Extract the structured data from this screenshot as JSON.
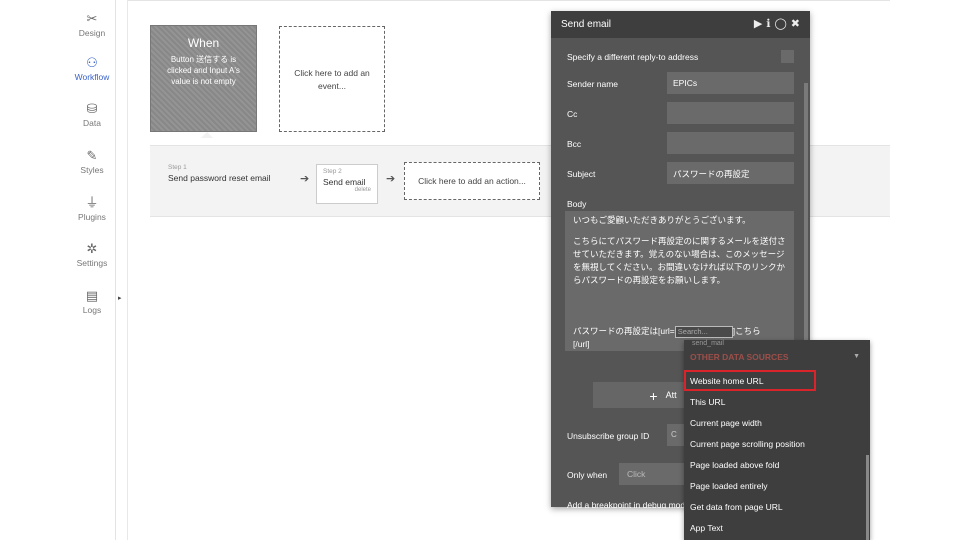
{
  "sidebar": {
    "items": [
      {
        "label": "Design",
        "icon": "✂"
      },
      {
        "label": "Workflow",
        "icon": "⚇"
      },
      {
        "label": "Data",
        "icon": "⛁"
      },
      {
        "label": "Styles",
        "icon": "✎"
      },
      {
        "label": "Plugins",
        "icon": "⏚"
      },
      {
        "label": "Settings",
        "icon": "✲"
      },
      {
        "label": "Logs",
        "icon": "▤"
      }
    ],
    "expand_icon": "▸"
  },
  "event": {
    "title": "When",
    "description": "Button 送信する is clicked and Input A's value is not empty",
    "add_event": "Click here to add an event..."
  },
  "actions": {
    "step1_label": "Step 1",
    "step1_title": "Send password reset email",
    "step2_label": "Step 2",
    "step2_title": "Send email",
    "step2_delete": "delete",
    "add_action": "Click here to add an action...",
    "arrow": "➔"
  },
  "panel": {
    "title": "Send email",
    "icons": {
      "play": "▶",
      "info": "ℹ",
      "comment": "◯",
      "close": "✖"
    },
    "reply_to_label": "Specify a different reply-to address",
    "sender_name_label": "Sender name",
    "sender_name_value": "EPICs",
    "cc_label": "Cc",
    "bcc_label": "Bcc",
    "subject_label": "Subject",
    "subject_value": "パスワードの再設定",
    "body_label": "Body",
    "body_p1": "いつもご愛顧いただきありがとうございます。",
    "body_p2": "こちらにてパスワード再設定のに関するメールを送付させていただきます。覚えのない場合は、このメッセージを無視してください。お間違いなければ以下のリンクからパスワードの再設定をお願いします。",
    "body_last_prefix": "パスワードの再設定は[url=",
    "body_search_placeholder": "Search...",
    "body_last_suffix": "]こちら",
    "body_last_line2": "[/url]",
    "attach_plus": "+",
    "attach_label": "Att",
    "unsubscribe_label": "Unsubscribe group ID",
    "unsubscribe_value": "C",
    "only_when_label": "Only when",
    "only_when_value": "Click",
    "breakpoint_label": "Add a breakpoint in debug mode"
  },
  "dropdown": {
    "clipped_top": "send_mail",
    "section": "OTHER DATA SOURCES",
    "caret": "▼",
    "items": [
      "Website home URL",
      "This URL",
      "Current page width",
      "Current page scrolling position",
      "Page loaded above fold",
      "Page loaded entirely",
      "Get data from page URL",
      "App Text"
    ],
    "highlight_color": "#d9242b"
  }
}
